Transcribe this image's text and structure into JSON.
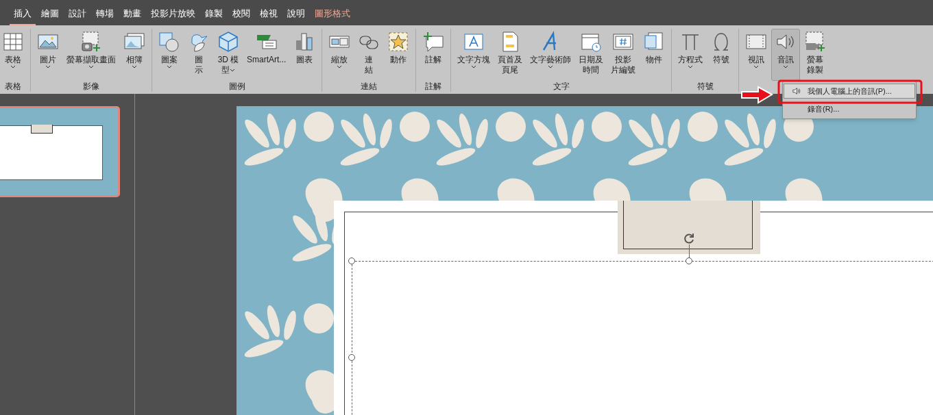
{
  "tabs": [
    {
      "label": "插入",
      "selected": true,
      "kind": "normal"
    },
    {
      "label": "繪圖",
      "selected": false,
      "kind": "normal"
    },
    {
      "label": "設計",
      "selected": false,
      "kind": "normal"
    },
    {
      "label": "轉場",
      "selected": false,
      "kind": "normal"
    },
    {
      "label": "動畫",
      "selected": false,
      "kind": "normal"
    },
    {
      "label": "投影片放映",
      "selected": false,
      "kind": "normal"
    },
    {
      "label": "錄製",
      "selected": false,
      "kind": "normal"
    },
    {
      "label": "校閱",
      "selected": false,
      "kind": "normal"
    },
    {
      "label": "檢視",
      "selected": false,
      "kind": "normal"
    },
    {
      "label": "說明",
      "selected": false,
      "kind": "normal"
    },
    {
      "label": "圖形格式",
      "selected": false,
      "kind": "contextual"
    }
  ],
  "ribbon_groups": [
    {
      "label": "表格",
      "items": [
        {
          "lines": [
            "表格"
          ],
          "dropdown": true,
          "pressed": false
        }
      ]
    },
    {
      "label": "影像",
      "items": [
        {
          "lines": [
            "圖片"
          ],
          "dropdown": true,
          "pressed": false
        },
        {
          "lines": [
            "螢幕擷取畫面"
          ],
          "dropdown": true,
          "pressed": false
        },
        {
          "lines": [
            "相簿"
          ],
          "dropdown": true,
          "pressed": false
        }
      ]
    },
    {
      "label": "圖例",
      "items": [
        {
          "lines": [
            "圖案"
          ],
          "dropdown": true,
          "pressed": false
        },
        {
          "lines": [
            "圖",
            "示"
          ],
          "dropdown": false,
          "pressed": false
        },
        {
          "lines": [
            "3D 模",
            "型"
          ],
          "dropdown": true,
          "pressed": false
        },
        {
          "lines": [
            "SmartArt..."
          ],
          "dropdown": false,
          "pressed": false
        },
        {
          "lines": [
            "圖表"
          ],
          "dropdown": false,
          "pressed": false
        }
      ]
    },
    {
      "label": "連結",
      "items": [
        {
          "lines": [
            "縮放"
          ],
          "dropdown": true,
          "pressed": false
        },
        {
          "lines": [
            "連",
            "結"
          ],
          "dropdown": false,
          "pressed": false
        },
        {
          "lines": [
            "動作"
          ],
          "dropdown": false,
          "pressed": false
        }
      ]
    },
    {
      "label": "註解",
      "items": [
        {
          "lines": [
            "註解"
          ],
          "dropdown": false,
          "pressed": false
        }
      ]
    },
    {
      "label": "文字",
      "items": [
        {
          "lines": [
            "文字方塊"
          ],
          "dropdown": true,
          "pressed": false
        },
        {
          "lines": [
            "頁首及",
            "頁尾"
          ],
          "dropdown": false,
          "pressed": false
        },
        {
          "lines": [
            "文字藝術師"
          ],
          "dropdown": true,
          "pressed": false
        },
        {
          "lines": [
            "日期及",
            "時間"
          ],
          "dropdown": false,
          "pressed": false
        },
        {
          "lines": [
            "投影",
            "片編號"
          ],
          "dropdown": false,
          "pressed": false
        },
        {
          "lines": [
            "物件"
          ],
          "dropdown": false,
          "pressed": false
        }
      ]
    },
    {
      "label": "符號",
      "items": [
        {
          "lines": [
            "方程式"
          ],
          "dropdown": true,
          "pressed": false
        },
        {
          "lines": [
            "符號"
          ],
          "dropdown": false,
          "pressed": false
        }
      ]
    },
    {
      "items": [
        {
          "lines": [
            "視訊"
          ],
          "dropdown": true,
          "pressed": false
        },
        {
          "lines": [
            "音訊"
          ],
          "dropdown": true,
          "pressed": true
        },
        {
          "lines": [
            "螢幕",
            "錄製"
          ],
          "dropdown": false,
          "pressed": false
        }
      ]
    }
  ],
  "audio_menu": [
    {
      "label": "我個人電腦上的音訊(P)...",
      "selected": true
    },
    {
      "label": "錄音(R)...",
      "selected": false
    }
  ],
  "slides": [
    {
      "selected": true
    }
  ]
}
